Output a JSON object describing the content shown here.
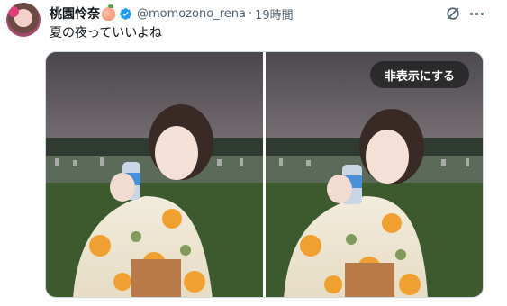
{
  "author": {
    "display_name": "桃園怜奈",
    "emoji_icon": "peach-icon",
    "verified_icon": "verified-badge-icon",
    "handle": "@momozono_rena",
    "separator": "·",
    "time": "19時間"
  },
  "tweet": {
    "text": "夏の夜っていいよね"
  },
  "media": {
    "hide_label": "非表示にする",
    "image_count": 2
  },
  "header_actions": [
    "grok-icon",
    "more-icon"
  ],
  "colors": {
    "verified": "#1d9bf0",
    "secondary_text": "#536471",
    "primary_text": "#0f1419"
  }
}
